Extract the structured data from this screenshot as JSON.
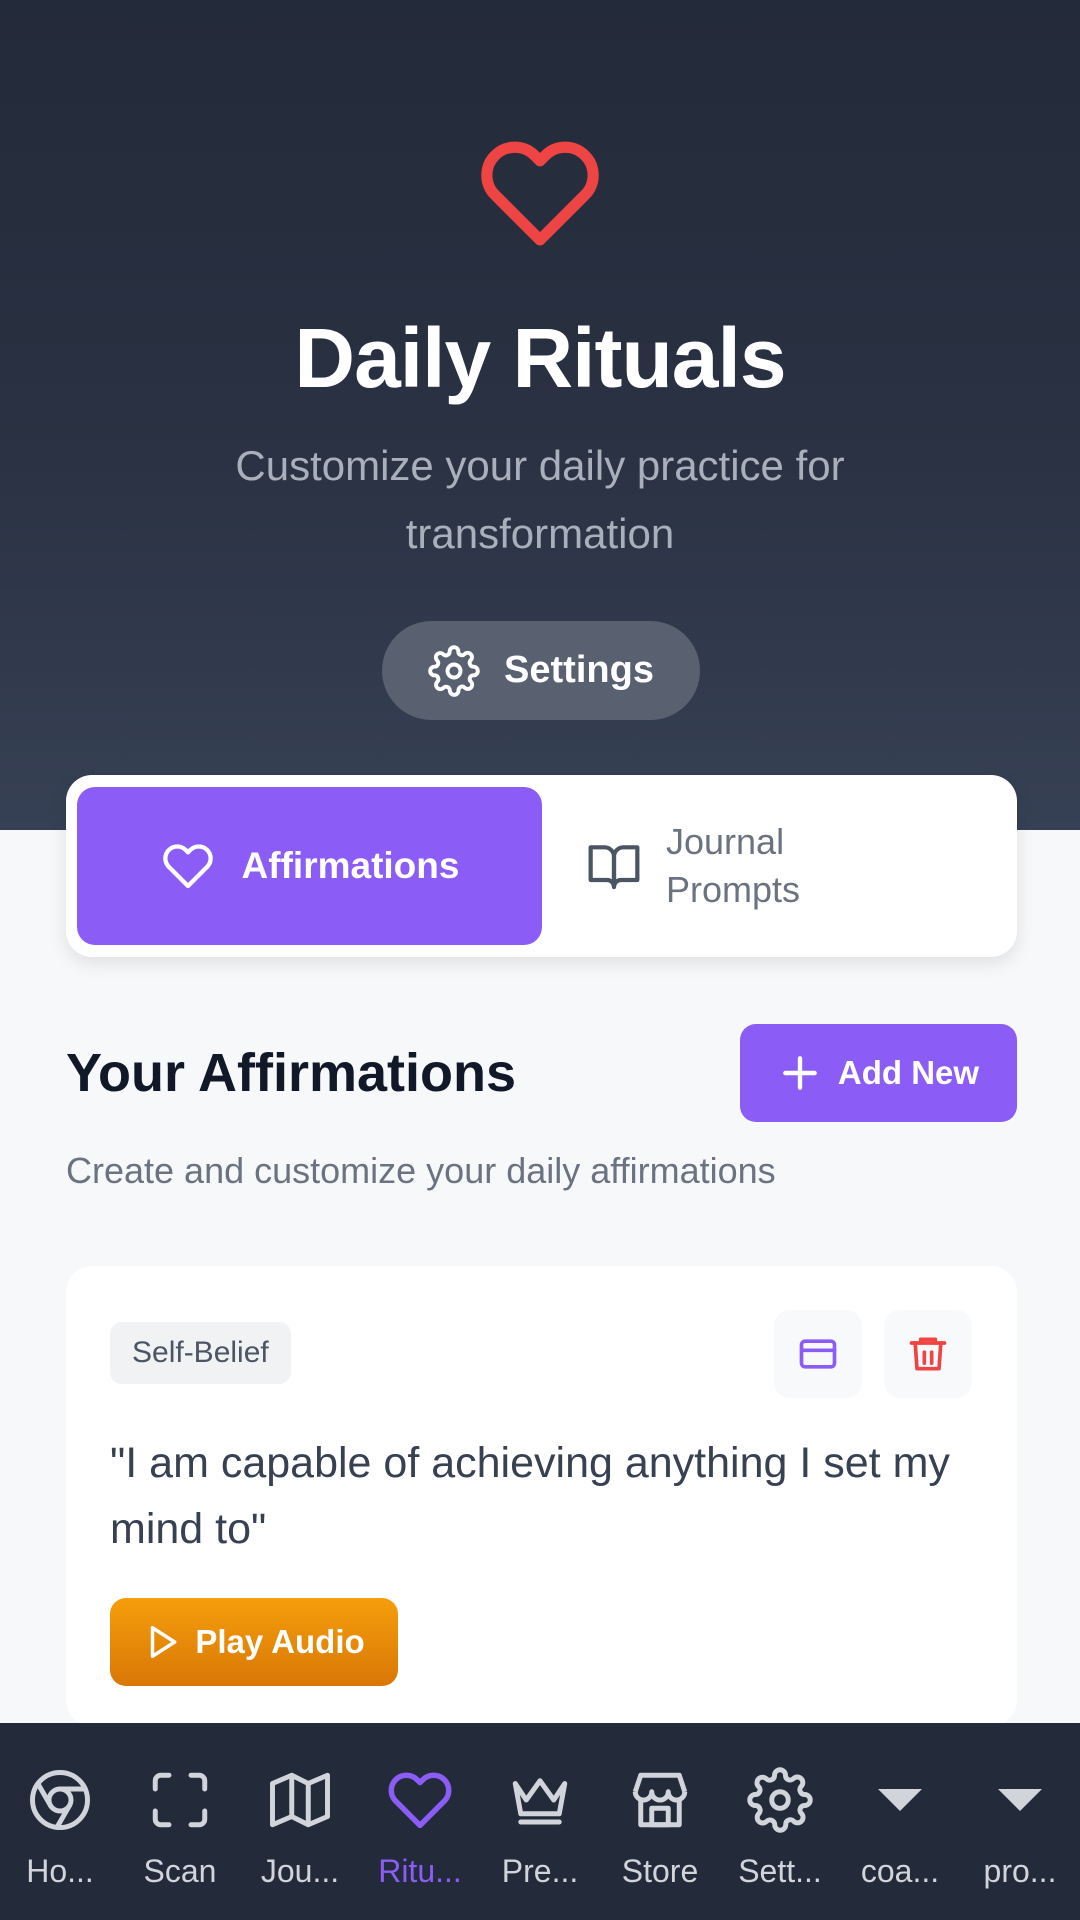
{
  "header": {
    "icon": "heart-icon",
    "title": "Daily Rituals",
    "subtitle": "Customize your daily practice for transformation",
    "settings_label": "Settings"
  },
  "tabs": [
    {
      "label": "Affirmations",
      "icon": "heart-icon",
      "active": true
    },
    {
      "label": "Journal Prompts",
      "icon": "book-open-icon",
      "active": false
    }
  ],
  "section": {
    "title": "Your Affirmations",
    "subtitle": "Create and customize your daily affirmations",
    "add_label": "Add New"
  },
  "affirmations": [
    {
      "category": "Self-Belief",
      "text": "\"I am capable of achieving anything I set my mind to\"",
      "play_label": "Play Audio"
    }
  ],
  "bottom_nav": [
    {
      "label": "Ho...",
      "icon": "chrome-icon",
      "active": false
    },
    {
      "label": "Scan",
      "icon": "scan-icon",
      "active": false
    },
    {
      "label": "Jou...",
      "icon": "map-icon",
      "active": false
    },
    {
      "label": "Ritu...",
      "icon": "heart-icon",
      "active": true
    },
    {
      "label": "Pre...",
      "icon": "crown-icon",
      "active": false
    },
    {
      "label": "Store",
      "icon": "store-icon",
      "active": false
    },
    {
      "label": "Sett...",
      "icon": "gear-icon",
      "active": false
    },
    {
      "label": "coa...",
      "icon": "caret-down-icon",
      "active": false
    },
    {
      "label": "pro...",
      "icon": "caret-down-icon",
      "active": false
    }
  ],
  "colors": {
    "accent": "#8b5cf6",
    "heart_red": "#ef4444",
    "play_orange": "#f59e0b",
    "hero_bg": "#232a39"
  }
}
